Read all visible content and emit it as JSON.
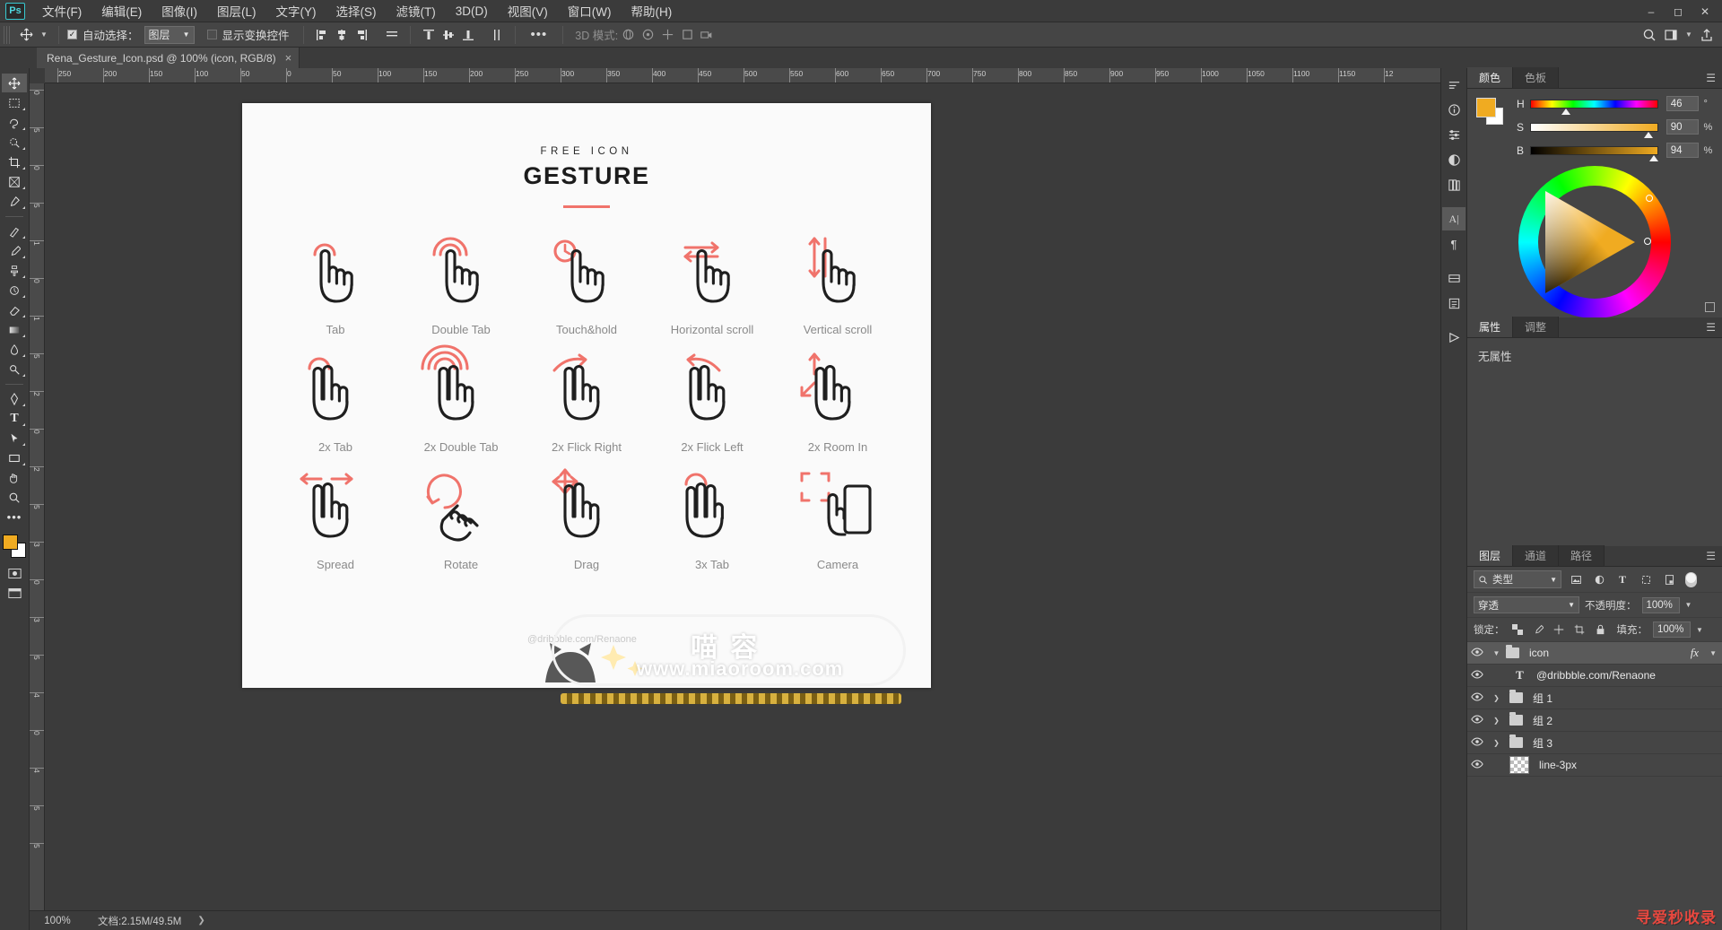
{
  "app": {
    "logo": "Ps",
    "menus": [
      "文件(F)",
      "编辑(E)",
      "图像(I)",
      "图层(L)",
      "文字(Y)",
      "选择(S)",
      "滤镜(T)",
      "3D(D)",
      "视图(V)",
      "窗口(W)",
      "帮助(H)"
    ],
    "window_buttons": [
      "minimize",
      "maximize",
      "close"
    ]
  },
  "options_bar": {
    "auto_select_checked": true,
    "auto_select_label": "自动选择：",
    "auto_select_value": "图层",
    "show_transform_label": "显示变换控件",
    "show_transform_checked": false,
    "more_label": "•••",
    "mode_3d_label": "3D 模式:"
  },
  "document_tab": {
    "title": "Rena_Gesture_Icon.psd @ 100% (icon, RGB/8)",
    "close": "×"
  },
  "canvas": {
    "title_small": "FREE ICON",
    "title_big": "GESTURE",
    "rows": [
      [
        {
          "label": "Tab",
          "icon": "tap-gesture-icon"
        },
        {
          "label": "Double Tab",
          "icon": "double-tap-gesture-icon"
        },
        {
          "label": "Touch&hold",
          "icon": "touch-hold-gesture-icon"
        },
        {
          "label": "Horizontal scroll",
          "icon": "horizontal-scroll-gesture-icon"
        },
        {
          "label": "Vertical scroll",
          "icon": "vertical-scroll-gesture-icon"
        }
      ],
      [
        {
          "label": "2x Tab",
          "icon": "two-finger-tap-icon"
        },
        {
          "label": "2x Double Tab",
          "icon": "two-finger-double-tap-icon"
        },
        {
          "label": "2x Flick Right",
          "icon": "two-finger-flick-right-icon"
        },
        {
          "label": "2x Flick Left",
          "icon": "two-finger-flick-left-icon"
        },
        {
          "label": "2x Room In",
          "icon": "two-finger-zoom-in-icon"
        }
      ],
      [
        {
          "label": "Spread",
          "icon": "spread-gesture-icon"
        },
        {
          "label": "Rotate",
          "icon": "rotate-gesture-icon"
        },
        {
          "label": "Drag",
          "icon": "drag-gesture-icon"
        },
        {
          "label": "3x Tab",
          "icon": "three-finger-tap-icon"
        },
        {
          "label": "Camera",
          "icon": "camera-gesture-icon"
        }
      ]
    ],
    "credit": "@dribbble.com/Renaone",
    "accent_color": "#f0736b",
    "background_color": "#fafafa"
  },
  "watermark": {
    "cn_text": "喵 容",
    "url_text": "www.miaoroom.com",
    "bottom_right": "寻爱秒收录"
  },
  "rulers": {
    "horizontal": [
      "250",
      "200",
      "150",
      "100",
      "50",
      "0",
      "50",
      "100",
      "150",
      "200",
      "250",
      "300",
      "350",
      "400",
      "450",
      "500",
      "550",
      "600",
      "650",
      "700",
      "750",
      "800",
      "850",
      "900",
      "950",
      "1000",
      "1050",
      "1100",
      "1150",
      "12"
    ],
    "vertical": [
      "0",
      "5",
      "0",
      "5",
      "1",
      "0",
      "1",
      "5",
      "2",
      "0",
      "2",
      "5",
      "3",
      "0",
      "3",
      "5",
      "4",
      "0",
      "4",
      "5",
      "5"
    ]
  },
  "status_bar": {
    "zoom": "100%",
    "doc_info": "文档:2.15M/49.5M",
    "arrow": "❯"
  },
  "color_panel": {
    "tabs": [
      {
        "label": "颜色",
        "active": true
      },
      {
        "label": "色板",
        "active": false
      }
    ],
    "sliders": [
      {
        "name": "H",
        "value": "46",
        "unit": "°",
        "pos": 27
      },
      {
        "name": "S",
        "value": "90",
        "unit": "%",
        "pos": 90
      },
      {
        "name": "B",
        "value": "94",
        "unit": "%",
        "pos": 94
      }
    ],
    "foreground": "#f0ab21",
    "background": "#ffffff"
  },
  "properties_panel": {
    "tabs": [
      {
        "label": "属性",
        "active": true
      },
      {
        "label": "调整",
        "active": false
      }
    ],
    "empty_text": "无属性"
  },
  "layers_panel": {
    "tabs": [
      {
        "label": "图层",
        "active": true
      },
      {
        "label": "通道",
        "active": false
      },
      {
        "label": "路径",
        "active": false
      }
    ],
    "filter_placeholder": "类型",
    "blend_mode": "穿透",
    "opacity_label": "不透明度：",
    "opacity_value": "100%",
    "lock_label": "锁定：",
    "fill_label": "填充：",
    "fill_value": "100%",
    "layers": [
      {
        "name": "icon",
        "type": "group",
        "expanded": true,
        "visible": true,
        "selected": true,
        "fx": "fx"
      },
      {
        "name": "@dribbble.com/Renaone",
        "type": "text",
        "visible": true,
        "selected": false
      },
      {
        "name": "组 1",
        "type": "group",
        "expanded": false,
        "visible": true,
        "selected": false
      },
      {
        "name": "组 2",
        "type": "group",
        "expanded": false,
        "visible": true,
        "selected": false
      },
      {
        "name": "组 3",
        "type": "group",
        "expanded": false,
        "visible": true,
        "selected": false
      },
      {
        "name": "line-3px",
        "type": "raster",
        "visible": true,
        "selected": false
      }
    ]
  },
  "toolbar": {
    "tools": [
      "move-tool",
      "marquee-tool",
      "lasso-tool",
      "quick-select-tool",
      "crop-tool",
      "frame-tool",
      "eyedropper-tool",
      "healing-brush-tool",
      "brush-tool",
      "clone-stamp-tool",
      "history-brush-tool",
      "eraser-tool",
      "gradient-tool",
      "blur-tool",
      "dodge-tool",
      "pen-tool",
      "type-tool",
      "path-select-tool",
      "rectangle-tool",
      "hand-tool",
      "zoom-tool",
      "more-tools"
    ]
  },
  "right_rail": {
    "icons": [
      "history-icon",
      "info-icon",
      "brush-settings-icon",
      "adjustments-icon",
      "libraries-icon",
      "character-icon",
      "paragraph-icon",
      "timeline-icon",
      "notes-icon",
      "actions-icon"
    ]
  }
}
